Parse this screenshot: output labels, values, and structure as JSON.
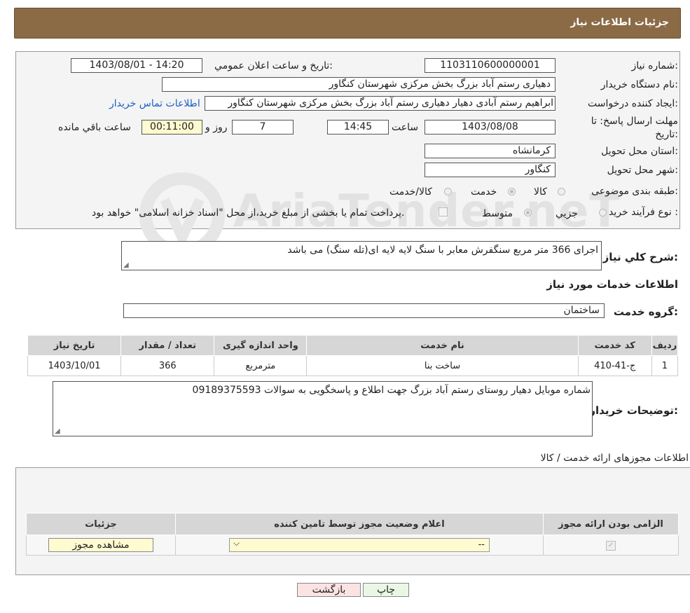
{
  "header": {
    "title": "جزئیات اطلاعات نیاز"
  },
  "watermark": {
    "text": "AriaTender.neT"
  },
  "form": {
    "need_number_label": "شماره نیاز:",
    "need_number": "1103110600000001",
    "announce_label": "تاریخ و ساعت اعلان عمومي:",
    "announce_value": "1403/08/01 - 14:20",
    "buyer_org_label": "نام دستگاه خریدار:",
    "buyer_org": "دهیاری رستم آباد بزرگ بخش مرکزی شهرستان کنگاور",
    "creator_label": "ایجاد کننده درخواست:",
    "creator": "ابراهیم رستم آبادی دهیار دهیاری رستم آباد بزرگ بخش مرکزی شهرستان کنگاور",
    "contact_link": "اطلاعات تماس خریدار",
    "deadline_label_1": "مهلت ارسال پاسخ: تا",
    "deadline_label_2": "تاریخ:",
    "deadline_date": "1403/08/08",
    "time_label": "ساعت",
    "deadline_time": "14:45",
    "days_value": "7",
    "days_label": "روز و",
    "remaining_time": "00:11:00",
    "remaining_label": "ساعت باقي مانده",
    "province_label": "استان محل تحویل:",
    "province": "کرمانشاه",
    "city_label": "شهر محل تحویل:",
    "city": "کنگاور",
    "category_label": "طبقه بندی موضوعی:",
    "category_options": [
      "کالا",
      "خدمت",
      "کالا/خدمت"
    ],
    "category_selected": "خدمت",
    "process_label": "نوع فرآیند خرید :",
    "process_options": [
      "جزیي",
      "متوسط"
    ],
    "process_selected": "متوسط",
    "payment_note": "پرداخت تمام یا بخشی از مبلغ خرید،از محل \"اسناد خزانه اسلامی\" خواهد بود."
  },
  "summary": {
    "label": "شرح کلي نیاز:",
    "text": "اجرای 366 متر مربع سنگفرش معابر با سنگ لایه لایه ای(تله سنگ) می باشد"
  },
  "services": {
    "section_title": "اطلاعات خدمات مورد نیاز",
    "group_label": "گروه خدمت:",
    "group_value": "ساختمان",
    "columns": [
      "ردیف",
      "کد خدمت",
      "نام خدمت",
      "واحد اندازه گیری",
      "تعداد / مقدار",
      "تاریخ نیاز"
    ],
    "rows": [
      {
        "index": "1",
        "code": "ج-41-410",
        "name": "ساخت بنا",
        "unit": "مترمربع",
        "qty": "366",
        "date": "1403/10/01"
      }
    ]
  },
  "buyer_notes": {
    "label": "توضیحات خریدار:",
    "text": "شماره موبایل دهیار روستای رستم آباد بزرگ جهت اطلاع و پاسخگویی به سوالات 09189375593"
  },
  "permits": {
    "section_title": "اطلاعات مجوزهای ارائه خدمت / کالا",
    "columns": [
      "الزامی بودن ارائه مجوز",
      "اعلام وضعیت مجوز توسط تامین کننده",
      "جزئیات"
    ],
    "select_value": "--",
    "view_button": "مشاهده مجوز"
  },
  "buttons": {
    "print": "چاپ",
    "back": "بازگشت"
  },
  "colors": {
    "header_bg": "#8b6a46",
    "back_button_bg": "#fbe3e3",
    "print_button_bg": "#eaf7e4",
    "permit_button_bg": "#fffbd0",
    "link": "#1a5fc7"
  }
}
